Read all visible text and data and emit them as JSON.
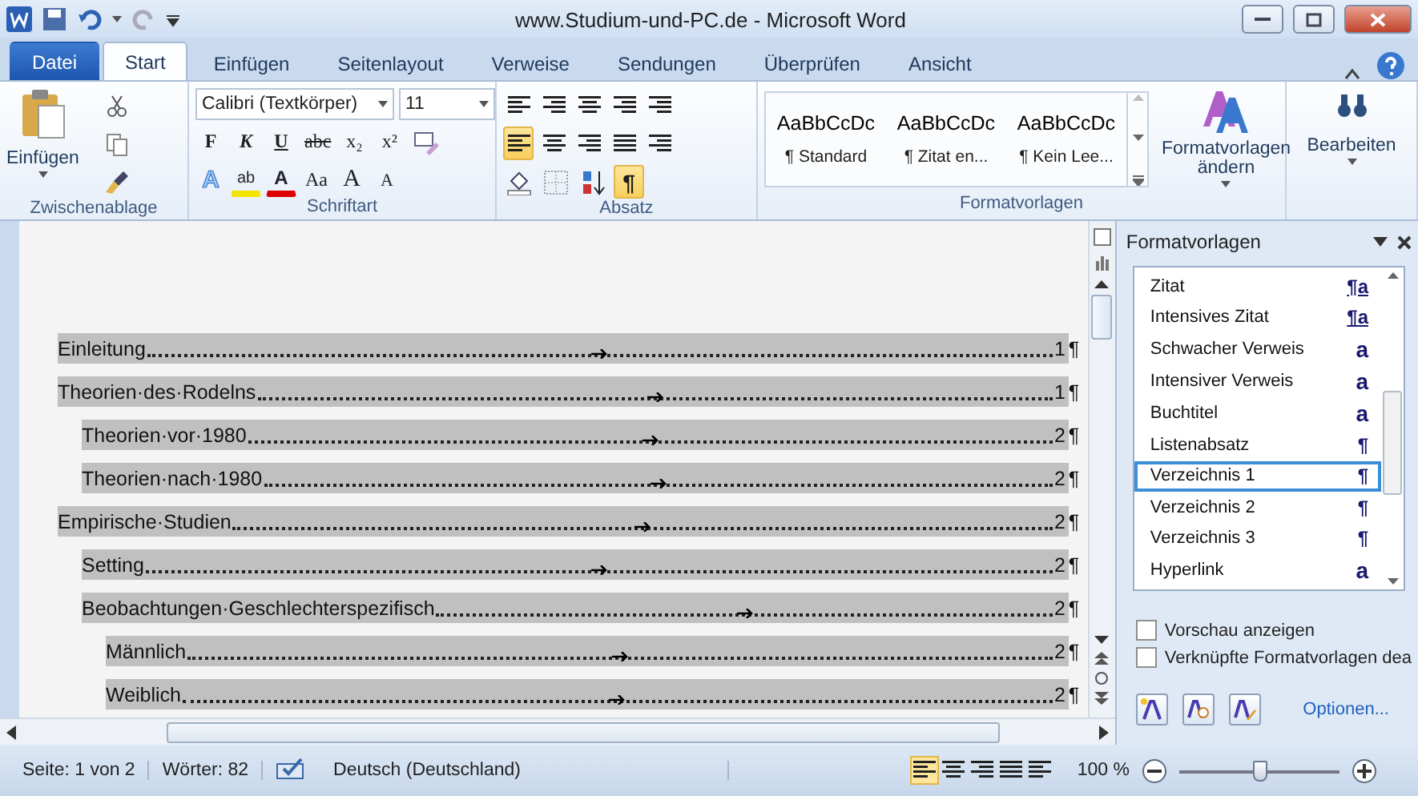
{
  "window": {
    "title": "www.Studium-und-PC.de - Microsoft Word"
  },
  "tabs": [
    {
      "label": "Datei",
      "kind": "file",
      "selected": false
    },
    {
      "label": "Start",
      "kind": "tab",
      "selected": true
    },
    {
      "label": "Einfügen",
      "kind": "tab",
      "selected": false
    },
    {
      "label": "Seitenlayout",
      "kind": "tab",
      "selected": false
    },
    {
      "label": "Verweise",
      "kind": "tab",
      "selected": false
    },
    {
      "label": "Sendungen",
      "kind": "tab",
      "selected": false
    },
    {
      "label": "Überprüfen",
      "kind": "tab",
      "selected": false
    },
    {
      "label": "Ansicht",
      "kind": "tab",
      "selected": false
    }
  ],
  "ribbon": {
    "clipboard": {
      "paste": "Einfügen",
      "label": "Zwischenablage"
    },
    "font": {
      "name": "Calibri (Textkörper)",
      "size": "11",
      "format_buttons": [
        "F",
        "K",
        "U",
        "abc",
        "x₂",
        "x²"
      ],
      "text_effect": "A",
      "highlight": "ab",
      "font_color": "A",
      "case_button": "Aa",
      "grow": "A",
      "shrink": "A",
      "label": "Schriftart"
    },
    "paragraph": {
      "label": "Absatz",
      "align": [
        {
          "selected": true
        },
        {
          "selected": false
        },
        {
          "selected": false
        },
        {
          "selected": false
        }
      ],
      "show_marks": {
        "label": "¶",
        "selected": true
      }
    },
    "styles": {
      "gallery": [
        {
          "preview": "AaBbCcDc",
          "name": "¶ Standard"
        },
        {
          "preview": "AaBbCcDc",
          "name": "¶ Zitat en..."
        },
        {
          "preview": "AaBbCcDc",
          "name": "¶ Kein Lee..."
        }
      ],
      "change": "Formatvorlagen ändern",
      "label": "Formatvorlagen"
    },
    "editing": {
      "label": "Bearbeiten"
    }
  },
  "document": {
    "toc": [
      {
        "title": "Einleitung",
        "page": "1",
        "mark": "¶"
      },
      {
        "title": "Theorien·des·Rodelns",
        "page": "1",
        "mark": "¶",
        "children": [
          {
            "title": "Theorien·vor·1980",
            "page": "2",
            "mark": "¶"
          },
          {
            "title": "Theorien·nach·1980",
            "page": "2",
            "mark": "¶"
          }
        ]
      },
      {
        "title": "Empirische·Studien",
        "page": "2",
        "mark": "¶",
        "children": [
          {
            "title": "Setting",
            "page": "2",
            "mark": "¶"
          },
          {
            "title": "Beobachtungen·Geschlechterspezifisch",
            "page": "2",
            "mark": "¶",
            "children": [
              {
                "title": "Männlich",
                "page": "2",
                "mark": "¶"
              },
              {
                "title": "Weiblich",
                "page": "2",
                "mark": "¶"
              }
            ]
          }
        ]
      }
    ]
  },
  "styles_pane": {
    "title": "Formatvorlagen",
    "styles": [
      {
        "name": "Zitat",
        "symbol": "¶a",
        "kind": "linked",
        "selected": false
      },
      {
        "name": "Intensives Zitat",
        "symbol": "¶a",
        "kind": "linked",
        "selected": false
      },
      {
        "name": "Schwacher Verweis",
        "symbol": "a",
        "kind": "character",
        "selected": false
      },
      {
        "name": "Intensiver Verweis",
        "symbol": "a",
        "kind": "character",
        "selected": false
      },
      {
        "name": "Buchtitel",
        "symbol": "a",
        "kind": "character",
        "selected": false
      },
      {
        "name": "Listenabsatz",
        "symbol": "¶",
        "kind": "paragraph",
        "selected": false
      },
      {
        "name": "Verzeichnis 1",
        "symbol": "¶",
        "kind": "paragraph",
        "selected": true
      },
      {
        "name": "Verzeichnis 2",
        "symbol": "¶",
        "kind": "paragraph",
        "selected": false
      },
      {
        "name": "Verzeichnis 3",
        "symbol": "¶",
        "kind": "paragraph",
        "selected": false
      },
      {
        "name": "Hyperlink",
        "symbol": "a",
        "kind": "character",
        "selected": false
      }
    ],
    "options": [
      {
        "label": "Vorschau anzeigen",
        "checked": false
      },
      {
        "label": "Verknüpfte Formatvorlagen dea",
        "checked": false
      }
    ],
    "link": "Optionen..."
  },
  "status_bar": {
    "page": "Seite: 1 von 2",
    "words": "Wörter: 82",
    "language": "Deutsch (Deutschland)",
    "views": [
      {
        "selected": true
      },
      {
        "selected": false
      },
      {
        "selected": false
      },
      {
        "selected": false
      },
      {
        "selected": false
      }
    ],
    "zoom": "100 %",
    "zoom_slider": {
      "level": 0.5
    }
  }
}
